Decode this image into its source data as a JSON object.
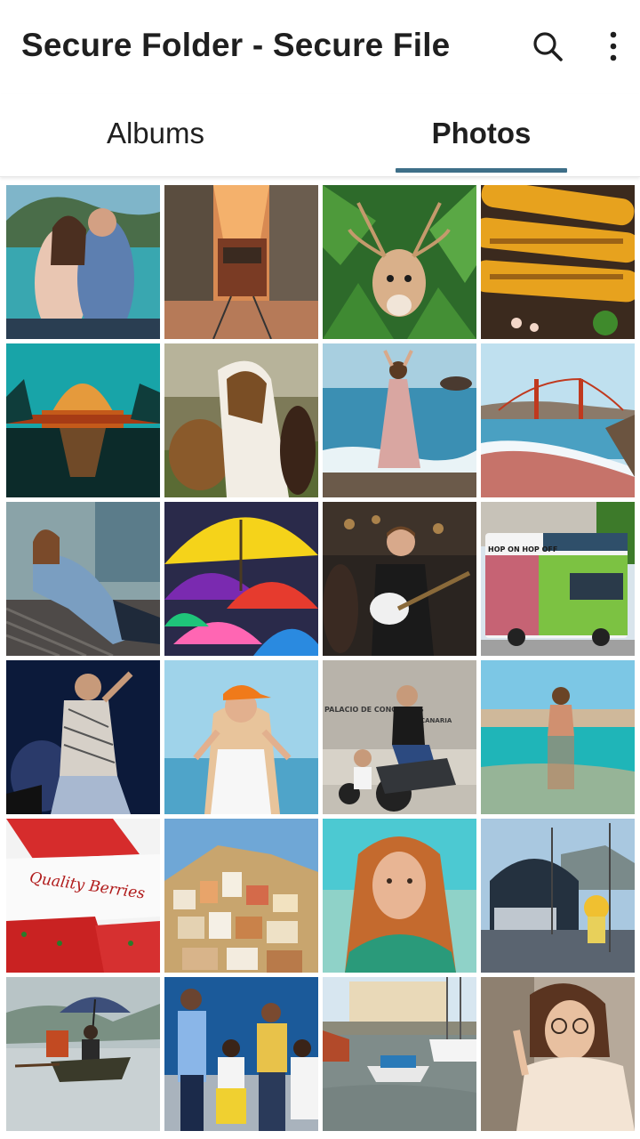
{
  "app": {
    "title": "Secure Folder - Secure File",
    "search_icon": "search-icon",
    "more_icon": "more-vert-icon"
  },
  "tabs": [
    {
      "label": "Albums",
      "selected": false
    },
    {
      "label": "Photos",
      "selected": true
    }
  ],
  "colors": {
    "tab_indicator": "#3e6f88",
    "title_text": "#1f1f1f"
  },
  "photos": [
    {
      "id": "couple-beach-selfie"
    },
    {
      "id": "cable-car-street"
    },
    {
      "id": "deer-in-ferns"
    },
    {
      "id": "grilled-corn"
    },
    {
      "id": "palace-of-fine-arts-night"
    },
    {
      "id": "horses"
    },
    {
      "id": "woman-dancing-by-sea"
    },
    {
      "id": "golden-gate-bridge-beach"
    },
    {
      "id": "woman-on-bench-sunglasses"
    },
    {
      "id": "colorful-umbrellas"
    },
    {
      "id": "guitarist-smiling"
    },
    {
      "id": "hop-on-hop-off-bus"
    },
    {
      "id": "singer-on-stage"
    },
    {
      "id": "woman-orange-cap-beach"
    },
    {
      "id": "man-on-scooter"
    },
    {
      "id": "woman-in-water-split-view"
    },
    {
      "id": "quality-berries-strawberries"
    },
    {
      "id": "hillside-town"
    },
    {
      "id": "woman-portrait-turquoise"
    },
    {
      "id": "boat-at-dock"
    },
    {
      "id": "man-with-umbrella-boat"
    },
    {
      "id": "group-office-people"
    },
    {
      "id": "canal-boats"
    },
    {
      "id": "woman-curly-hair-glasses"
    }
  ],
  "photo_texts": {
    "berries_box_label": "Quality Berries",
    "bus_banner": "HOP ON HOP OFF",
    "building_sign": "PALACIO DE CONGRESOS",
    "building_sign_sub": "CANARIA"
  }
}
